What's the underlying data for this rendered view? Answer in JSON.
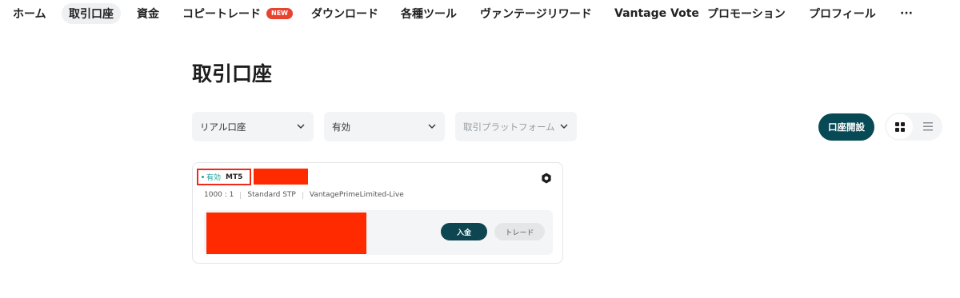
{
  "nav": {
    "items": [
      {
        "label": "ホーム"
      },
      {
        "label": "取引口座",
        "active": true
      },
      {
        "label": "資金"
      },
      {
        "label": "コピートレード",
        "badge": "NEW"
      },
      {
        "label": "ダウンロード"
      },
      {
        "label": "各種ツール"
      },
      {
        "label": "ヴァンテージリワード"
      },
      {
        "label": "Vantage Vote"
      },
      {
        "label": "プロモーション"
      },
      {
        "label": "プロフィール"
      },
      {
        "label": "···"
      }
    ],
    "badge_color": "#e8432f"
  },
  "page": {
    "title": "取引口座"
  },
  "filters": {
    "account_type": "リアル口座",
    "status": "有効",
    "platform_placeholder": "取引プラットフォーム"
  },
  "actions": {
    "open_account": "口座開設"
  },
  "view": {
    "grid_icon": "grid-icon",
    "list_icon": "list-icon",
    "selected": "grid"
  },
  "account_card": {
    "status": "有効",
    "platform": "MT5",
    "leverage": "1000 : 1",
    "account_type": "Standard STP",
    "server": "VantagePrimeLimited-Live",
    "deposit_label": "入金",
    "trade_label": "トレード",
    "settings_icon": "settings-icon"
  },
  "colors": {
    "primary": "#074a56",
    "status_green": "#1aa39a",
    "redaction": "#ff2a00"
  }
}
